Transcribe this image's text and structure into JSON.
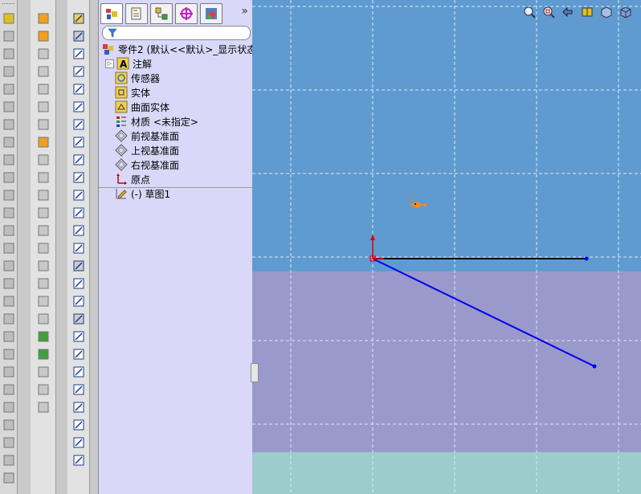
{
  "window": {
    "title": "零件2"
  },
  "colors": {
    "viewport_top": "#5f9bd0",
    "viewport_mid": "#9999cc",
    "viewport_bottom": "#9ccccc",
    "sketch_black": "#000000",
    "sketch_blue": "#0000ee",
    "origin_red": "#e00000",
    "panel_bg": "#d9d8f8"
  },
  "fmp": {
    "tabs": [
      {
        "name": "featuremanager-tab-icon"
      },
      {
        "name": "propertymanager-tab-icon"
      },
      {
        "name": "configurationmanager-tab-icon"
      },
      {
        "name": "dimxpert-tab-icon"
      },
      {
        "name": "display-manager-tab-icon"
      }
    ],
    "more": "»",
    "filter_icon": "filter-icon",
    "tree": {
      "root": "零件2  (默认<<默认>_显示状态",
      "items": [
        {
          "label": "注解",
          "icon": "annotations-icon"
        },
        {
          "label": "传感器",
          "icon": "sensors-icon"
        },
        {
          "label": "实体",
          "icon": "solid-bodies-icon"
        },
        {
          "label": "曲面实体",
          "icon": "surface-bodies-icon"
        },
        {
          "label": "材质 <未指定>",
          "icon": "material-icon"
        },
        {
          "label": "前视基准面",
          "icon": "plane-icon"
        },
        {
          "label": "上视基准面",
          "icon": "plane-icon"
        },
        {
          "label": "右视基准面",
          "icon": "plane-icon"
        },
        {
          "label": "原点",
          "icon": "origin-icon"
        },
        {
          "label": "(-) 草图1",
          "icon": "sketch-icon"
        }
      ]
    }
  },
  "viewport": {
    "hud_icons": [
      "zoom-to-fit-icon",
      "zoom-to-area-icon",
      "previous-view-icon",
      "section-view-icon",
      "view-orientation-icon",
      "display-style-icon"
    ]
  }
}
